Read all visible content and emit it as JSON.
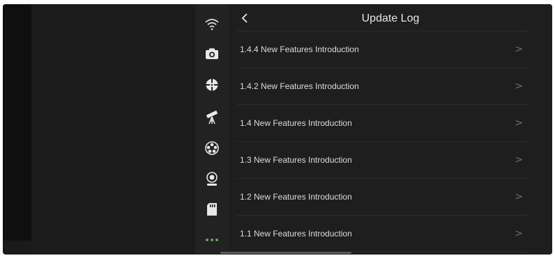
{
  "header": {
    "back_icon": "chevron-left-icon",
    "title": "Update Log"
  },
  "sidebar": {
    "icons": [
      "wifi-icon",
      "camera-icon",
      "focus-target-icon",
      "telescope-icon",
      "filter-wheel-icon",
      "webcam-icon",
      "sd-card-icon",
      "more-dots-icon"
    ],
    "active_color": "#4caf50"
  },
  "update_log": {
    "items": [
      {
        "label": "1.4.4 New Features Introduction"
      },
      {
        "label": "1.4.2 New Features Introduction"
      },
      {
        "label": "1.4 New Features Introduction"
      },
      {
        "label": "1.3 New Features Introduction"
      },
      {
        "label": "1.2 New Features Introduction"
      },
      {
        "label": "1.1 New Features Introduction"
      }
    ],
    "chevron_glyph": ">"
  }
}
